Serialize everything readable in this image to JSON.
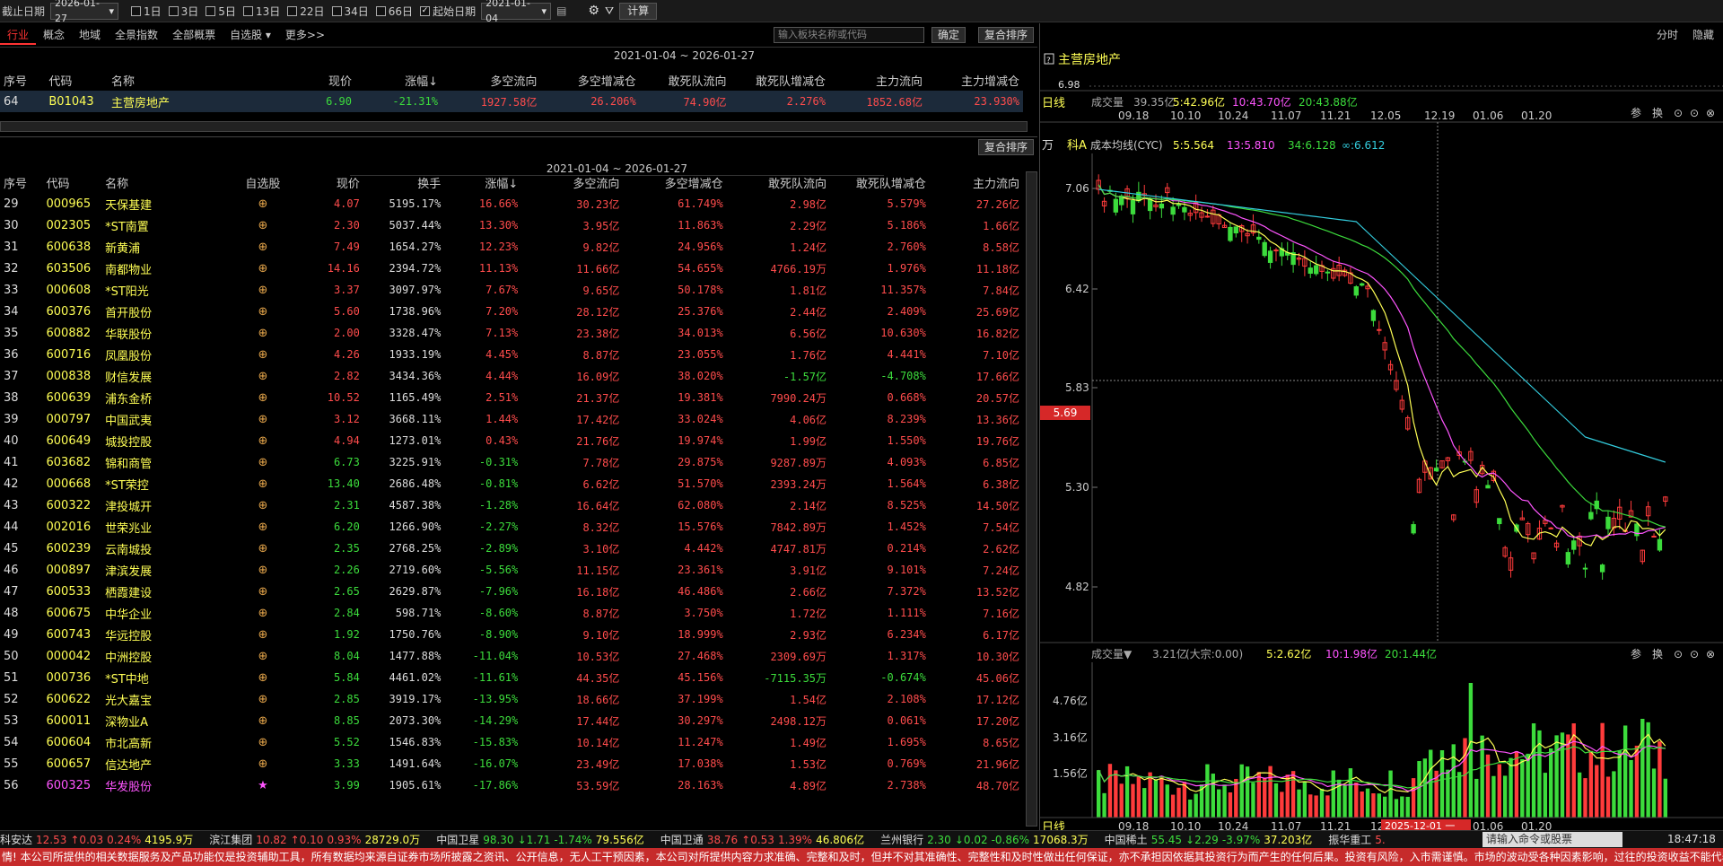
{
  "toolbar": {
    "end_date_label": "截止日期",
    "end_date": "2026-01-27",
    "periods": [
      {
        "label": "1日",
        "checked": false
      },
      {
        "label": "3日",
        "checked": false
      },
      {
        "label": "5日",
        "checked": false
      },
      {
        "label": "13日",
        "checked": false
      },
      {
        "label": "22日",
        "checked": false
      },
      {
        "label": "34日",
        "checked": false
      },
      {
        "label": "66日",
        "checked": false
      },
      {
        "label": "起始日期",
        "checked": true
      }
    ],
    "start_date": "2021-01-04",
    "calc_label": "计算"
  },
  "tabs": [
    "行业",
    "概念",
    "地域",
    "全景指数",
    "全部概票",
    "自选股 ▾",
    "更多>>"
  ],
  "search_placeholder": "输入板块名称或代码",
  "confirm_label": "确定",
  "sort_label": "复合排序",
  "sort_label2": "复合排序",
  "right_tabs": [
    "分时",
    "隐藏"
  ],
  "top_table": {
    "date_range": "2021-01-04 ~ 2026-01-27",
    "headers": [
      "序号",
      "代码",
      "名称",
      "现价",
      "涨幅↓",
      "多空流向",
      "多空增减仓",
      "敢死队流向",
      "敢死队增减仓",
      "主力流向",
      "主力增减仓"
    ],
    "row": [
      "64",
      "B01043",
      "主营房地产",
      "6.90",
      "-21.31%",
      "1927.58亿",
      "26.206%",
      "74.90亿",
      "2.276%",
      "1852.68亿",
      "23.930%"
    ]
  },
  "bottom_table": {
    "date_range": "2021-01-04 ~ 2026-01-27",
    "headers": [
      "序号",
      "代码",
      "名称",
      "自选股",
      "现价",
      "换手",
      "涨幅↓",
      "多空流向",
      "多空增减仓",
      "敢死队流向",
      "敢死队增减仓",
      "主力流向"
    ],
    "rows": [
      [
        "29",
        "000965",
        "天保基建",
        "4.07",
        "5195.17%",
        "16.66%",
        "30.23亿",
        "61.749%",
        "2.98亿",
        "5.579%",
        "27.26亿"
      ],
      [
        "30",
        "002305",
        "*ST南置",
        "2.30",
        "5037.44%",
        "13.30%",
        "3.95亿",
        "11.863%",
        "2.29亿",
        "5.186%",
        "1.66亿"
      ],
      [
        "31",
        "600638",
        "新黄浦",
        "7.49",
        "1654.27%",
        "12.23%",
        "9.82亿",
        "24.956%",
        "1.24亿",
        "2.760%",
        "8.58亿"
      ],
      [
        "32",
        "603506",
        "南都物业",
        "14.16",
        "2394.72%",
        "11.13%",
        "11.66亿",
        "54.655%",
        "4766.19万",
        "1.976%",
        "11.18亿"
      ],
      [
        "33",
        "000608",
        "*ST阳光",
        "3.37",
        "3097.97%",
        "7.67%",
        "9.65亿",
        "50.178%",
        "1.81亿",
        "11.357%",
        "7.84亿"
      ],
      [
        "34",
        "600376",
        "首开股份",
        "5.60",
        "1738.96%",
        "7.20%",
        "28.12亿",
        "25.376%",
        "2.44亿",
        "2.409%",
        "25.69亿"
      ],
      [
        "35",
        "600882",
        "华联股份",
        "2.00",
        "3328.47%",
        "7.13%",
        "23.38亿",
        "34.013%",
        "6.56亿",
        "10.630%",
        "16.82亿"
      ],
      [
        "36",
        "600716",
        "凤凰股份",
        "4.26",
        "1933.19%",
        "4.45%",
        "8.87亿",
        "23.055%",
        "1.76亿",
        "4.441%",
        "7.10亿"
      ],
      [
        "37",
        "000838",
        "财信发展",
        "2.82",
        "3434.36%",
        "4.44%",
        "16.09亿",
        "38.020%",
        "-1.57亿",
        "-4.708%",
        "17.66亿"
      ],
      [
        "38",
        "600639",
        "浦东金桥",
        "10.52",
        "1165.49%",
        "2.51%",
        "21.37亿",
        "19.381%",
        "7990.24万",
        "0.668%",
        "20.57亿"
      ],
      [
        "39",
        "000797",
        "中国武夷",
        "3.12",
        "3668.11%",
        "1.44%",
        "17.42亿",
        "33.024%",
        "4.06亿",
        "8.239%",
        "13.36亿"
      ],
      [
        "40",
        "600649",
        "城投控股",
        "4.94",
        "1273.01%",
        "0.43%",
        "21.76亿",
        "19.974%",
        "1.99亿",
        "1.550%",
        "19.76亿"
      ],
      [
        "41",
        "603682",
        "锦和商管",
        "6.73",
        "3225.91%",
        "-0.31%",
        "7.78亿",
        "29.875%",
        "9287.89万",
        "4.093%",
        "6.85亿"
      ],
      [
        "42",
        "000668",
        "*ST荣控",
        "13.40",
        "2686.48%",
        "-0.81%",
        "6.62亿",
        "51.570%",
        "2393.24万",
        "1.564%",
        "6.38亿"
      ],
      [
        "43",
        "600322",
        "津投城开",
        "2.31",
        "4587.38%",
        "-1.28%",
        "16.64亿",
        "62.080%",
        "2.14亿",
        "8.525%",
        "14.50亿"
      ],
      [
        "44",
        "002016",
        "世荣兆业",
        "6.20",
        "1266.90%",
        "-2.27%",
        "8.32亿",
        "15.576%",
        "7842.89万",
        "1.452%",
        "7.54亿"
      ],
      [
        "45",
        "600239",
        "云南城投",
        "2.35",
        "2768.25%",
        "-2.89%",
        "3.10亿",
        "4.442%",
        "4747.81万",
        "0.214%",
        "2.62亿"
      ],
      [
        "46",
        "000897",
        "津滨发展",
        "2.26",
        "2719.60%",
        "-5.56%",
        "11.15亿",
        "23.361%",
        "3.91亿",
        "9.101%",
        "7.24亿"
      ],
      [
        "47",
        "600533",
        "栖霞建设",
        "2.65",
        "2629.87%",
        "-7.96%",
        "16.18亿",
        "46.486%",
        "2.66亿",
        "7.372%",
        "13.52亿"
      ],
      [
        "48",
        "600675",
        "中华企业",
        "2.84",
        "598.71%",
        "-8.60%",
        "8.87亿",
        "3.750%",
        "1.72亿",
        "1.111%",
        "7.16亿"
      ],
      [
        "49",
        "600743",
        "华远控股",
        "1.92",
        "1750.76%",
        "-8.90%",
        "9.10亿",
        "18.999%",
        "2.93亿",
        "6.234%",
        "6.17亿"
      ],
      [
        "50",
        "000042",
        "中洲控股",
        "8.04",
        "1477.88%",
        "-11.04%",
        "10.53亿",
        "27.468%",
        "2309.69万",
        "1.317%",
        "10.30亿"
      ],
      [
        "51",
        "000736",
        "*ST中地",
        "5.84",
        "4461.02%",
        "-11.61%",
        "44.35亿",
        "45.156%",
        "-7115.35万",
        "-0.674%",
        "45.06亿"
      ],
      [
        "52",
        "600622",
        "光大嘉宝",
        "2.85",
        "3919.17%",
        "-13.95%",
        "18.66亿",
        "37.199%",
        "1.54亿",
        "2.108%",
        "17.12亿"
      ],
      [
        "53",
        "600011",
        "深物业A",
        "8.85",
        "2073.30%",
        "-14.29%",
        "17.44亿",
        "30.297%",
        "2498.12万",
        "0.061%",
        "17.20亿"
      ],
      [
        "54",
        "600604",
        "市北高新",
        "5.52",
        "1546.83%",
        "-15.83%",
        "10.14亿",
        "11.247%",
        "1.49亿",
        "1.695%",
        "8.65亿"
      ],
      [
        "55",
        "600657",
        "信达地产",
        "3.33",
        "1491.64%",
        "-16.07%",
        "23.49亿",
        "17.038%",
        "1.53亿",
        "0.769%",
        "21.96亿"
      ],
      [
        "56",
        "600325",
        "华发股份",
        "3.99",
        "1905.61%",
        "-17.86%",
        "53.59亿",
        "28.163%",
        "4.89亿",
        "2.738%",
        "48.70亿"
      ]
    ]
  },
  "chart_title": "主营房地产",
  "top_mini": {
    "price": "6.98",
    "label": "日线",
    "vol_label": "成交量",
    "vol_total": "39.35亿",
    "ma5": "5:42.96亿",
    "ma10": "10:43.70亿",
    "ma20": "20:43.88亿",
    "dates": [
      "09.18",
      "10.10",
      "10.24",
      "11.07",
      "11.21",
      "12.05",
      "12.19",
      "01.06",
      "01.20"
    ],
    "controls": [
      "参",
      "换"
    ]
  },
  "main_chart": {
    "unit": "万",
    "ind_prefix": "科A",
    "ind_name": "成本均线(CYC)",
    "ma5": "5:5.564",
    "ma13": "13:5.810",
    "ma34": "34:6.128",
    "mainf": "∞:6.612",
    "price_ticks": [
      "7.06",
      "6.42",
      "5.83",
      "5.30",
      "4.82"
    ],
    "current": "5.69"
  },
  "vol_chart": {
    "label": "成交量▼",
    "total": "3.21亿",
    "big": "(大宗:0.00)",
    "ma5": "5:2.62亿",
    "ma10": "10:1.98亿",
    "ma20": "20:1.44亿",
    "ticks": [
      "4.76亿",
      "3.16亿",
      "1.56亿"
    ],
    "controls": [
      "参",
      "换"
    ]
  },
  "bottom_axis": {
    "label": "日线",
    "dates": [
      "09.18",
      "10.10",
      "10.24",
      "11.07",
      "11.21",
      "12.05",
      "12.19",
      "01.06",
      "01.20"
    ],
    "cursor_date": "2025-12-01 一"
  },
  "chart_data": {
    "type": "candlestick",
    "series": [
      {
        "name": "5",
        "values": []
      },
      {
        "name": "13",
        "values": []
      },
      {
        "name": "34",
        "values": []
      },
      {
        "name": "∞",
        "values": []
      }
    ]
  },
  "status": [
    {
      "n": "科安达",
      "v": "12.53",
      "c": "↑0.03",
      "p": "0.24%",
      "a": "4195.9万",
      "dir": "up"
    },
    {
      "n": "滨江集团",
      "v": "10.82",
      "c": "↑0.10",
      "p": "0.93%",
      "a": "28729.0万",
      "dir": "up"
    },
    {
      "n": "中国卫星",
      "v": "98.30",
      "c": "↓1.71",
      "p": "-1.74%",
      "a": "79.556亿",
      "dir": "down"
    },
    {
      "n": "中国卫通",
      "v": "38.76",
      "c": "↑0.53",
      "p": "1.39%",
      "a": "46.806亿",
      "dir": "up"
    },
    {
      "n": "兰州银行",
      "v": "2.30",
      "c": "↓0.02",
      "p": "-0.86%",
      "a": "17068.3万",
      "dir": "down"
    },
    {
      "n": "中国稀土",
      "v": "55.45",
      "c": "↓2.29",
      "p": "-3.97%",
      "a": "37.203亿",
      "dir": "down"
    },
    {
      "n": "振华重工",
      "v": "5.",
      "c": "",
      "p": "",
      "a": "",
      "dir": "up"
    }
  ],
  "command_placeholder": "请输入命令或股票",
  "clock": "18:47:18",
  "disclaimer": "情! 本公司所提供的相关数据服务及产品功能仅是投资辅助工具，所有数据均来源自证券市场所披露之资讯、公开信息，无人工干预因素，本公司对所提供内容力求准确、完整和及时，但并不对其准确性、完整性和及时性做出任何保证，亦不承担因依据其投资行为而产生的任何后果。投资有风险，入市需谨慎。市场的波动受各种因素影响，过往的投资收益不能代表未来之收益，请您谨慎做出投资决策！"
}
